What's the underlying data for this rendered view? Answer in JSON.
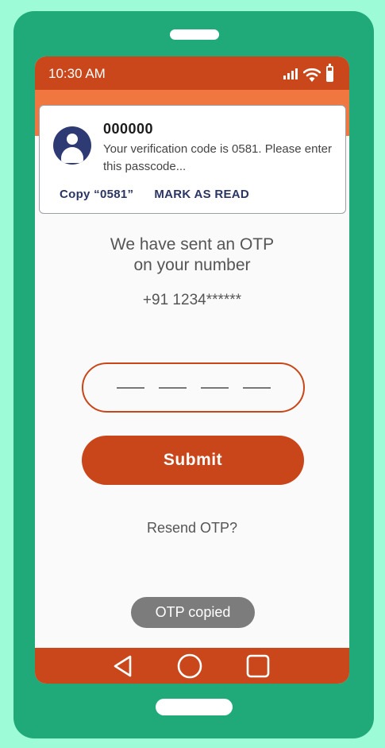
{
  "status_bar": {
    "time": "10:30 AM",
    "icons": [
      "signal-icon",
      "wifi-icon",
      "battery-icon"
    ]
  },
  "notification": {
    "sender": "000000",
    "body": "Your verification code is 0581. Please enter this passcode...",
    "actions": {
      "copy": "Copy “0581”",
      "mark_read": "MARK AS READ"
    },
    "avatar_icon": "user-avatar-icon"
  },
  "main": {
    "heading_line1": "We have sent an OTP",
    "heading_line2": "on your number",
    "phone_number": "+91 1234******",
    "otp_value": "",
    "submit_label": "Submit",
    "resend_label": "Resend OTP?"
  },
  "toast": {
    "message": "OTP copied"
  },
  "nav_bar": {
    "buttons": [
      "back-icon",
      "home-icon",
      "recents-icon"
    ]
  },
  "colors": {
    "background": "#9dfbd8",
    "device": "#20aa7a",
    "accent": "#c9461a",
    "status_shade": "#f07840",
    "notification_action": "#2a3563",
    "toast": "#7c7c7c"
  }
}
